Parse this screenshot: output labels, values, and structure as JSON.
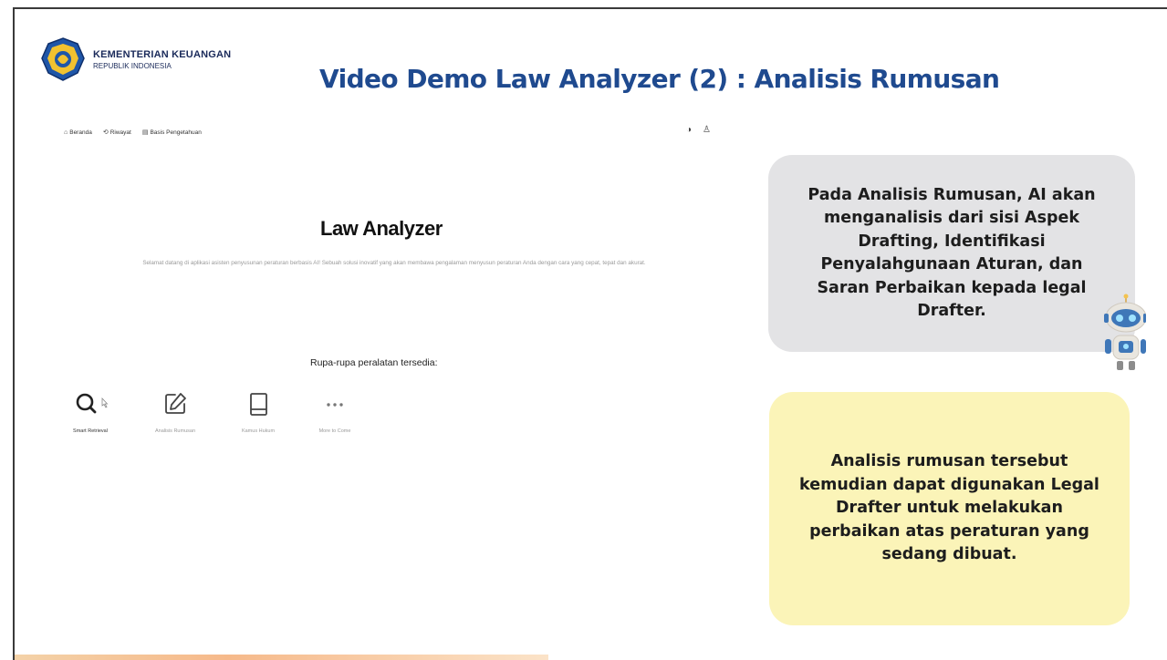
{
  "brand": {
    "org_name": "KEMENTERIAN KEUANGAN",
    "org_sub": "REPUBLIK INDONESIA"
  },
  "slide": {
    "title": "Video Demo Law Analyzer (2) : Analisis Rumusan"
  },
  "app": {
    "nav": [
      {
        "icon": "home-icon",
        "glyph": "⌂",
        "label": "Beranda"
      },
      {
        "icon": "history-icon",
        "glyph": "⟲",
        "label": "Riwayat"
      },
      {
        "icon": "book-icon",
        "glyph": "▤",
        "label": "Basis Pengetahuan"
      }
    ],
    "top_icons": [
      {
        "icon": "theme-toggle-icon",
        "glyph": "◑"
      },
      {
        "icon": "user-icon",
        "glyph": "♙"
      }
    ],
    "heading": "Law Analyzer",
    "description": "Selamat datang di aplikasi asisten penyusunan peraturan berbasis AI! Sebuah solusi inovatif yang akan membawa pengalaman menyusun peraturan Anda dengan cara yang cepat, tepat dan akurat.",
    "tools_title": "Rupa-rupa peralatan tersedia:",
    "tools": [
      {
        "icon": "search-icon",
        "label": "Smart Retrieval"
      },
      {
        "icon": "edit-icon",
        "label": "Analisis Rumusan"
      },
      {
        "icon": "book-icon",
        "label": "Kamus Hukum"
      },
      {
        "icon": "more-icon",
        "label": "More to Come"
      }
    ]
  },
  "callouts": {
    "first": "Pada Analisis Rumusan, AI akan menganalisis dari sisi Aspek Drafting, Identifikasi Penyalahgunaan Aturan, dan Saran Perbaikan kepada legal Drafter.",
    "second": "Analisis rumusan tersebut kemudian dapat digunakan Legal Drafter untuk melakukan perbaikan atas peraturan yang sedang dibuat."
  },
  "colors": {
    "title_blue": "#1f4a8f",
    "callout_gray": "#e3e3e5",
    "callout_yellow": "#fbf4b8"
  }
}
